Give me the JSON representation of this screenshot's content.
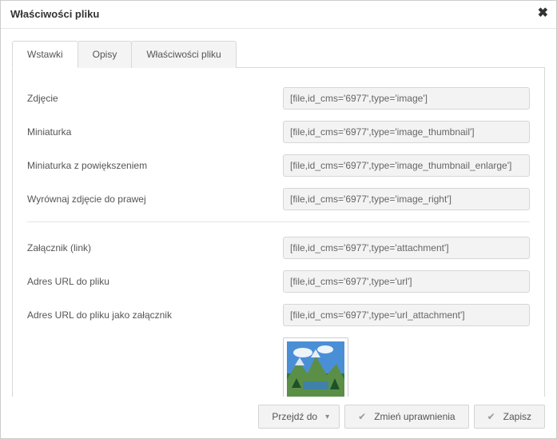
{
  "dialog": {
    "title": "Właściwości pliku"
  },
  "tabs": {
    "inserts": "Wstawki",
    "descriptions": "Opisy",
    "properties": "Właściwości pliku"
  },
  "rows": {
    "image": {
      "label": "Zdjęcie",
      "value": "[file,id_cms='6977',type='image']"
    },
    "thumb": {
      "label": "Miniaturka",
      "value": "[file,id_cms='6977',type='image_thumbnail']"
    },
    "thumb_enlarge": {
      "label": "Miniaturka z powiększeniem",
      "value": "[file,id_cms='6977',type='image_thumbnail_enlarge']"
    },
    "align_right": {
      "label": "Wyrównaj zdjęcie do prawej",
      "value": "[file,id_cms='6977',type='image_right']"
    },
    "attachment": {
      "label": "Załącznik (link)",
      "value": "[file,id_cms='6977',type='attachment']"
    },
    "url": {
      "label": "Adres URL do pliku",
      "value": "[file,id_cms='6977',type='url']"
    },
    "url_attachment": {
      "label": "Adres URL do pliku jako załącznik",
      "value": "[file,id_cms='6977',type='url_attachment']"
    }
  },
  "footer": {
    "goto": "Przejdź do",
    "perms": "Zmień uprawnienia",
    "save": "Zapisz"
  }
}
